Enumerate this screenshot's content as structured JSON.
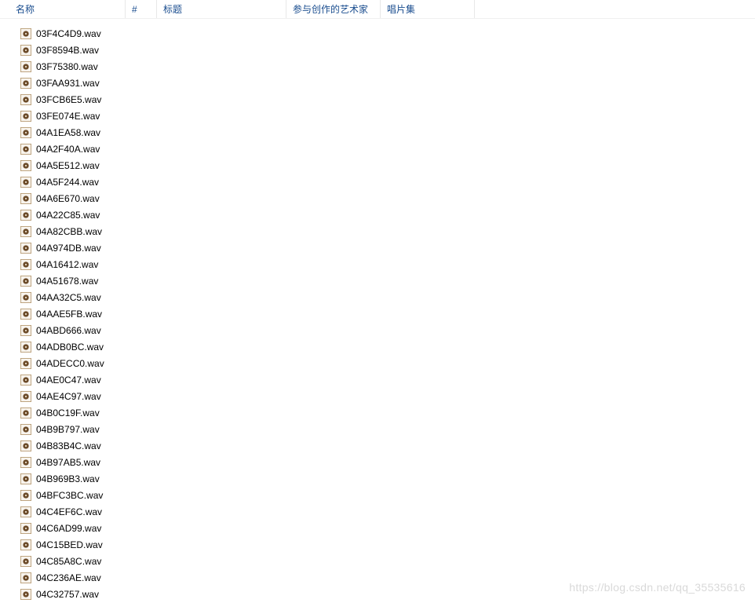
{
  "columns": {
    "name": "名称",
    "num": "#",
    "title": "标题",
    "artist": "参与创作的艺术家",
    "album": "唱片集"
  },
  "files": [
    "03F4C4D9.wav",
    "03F8594B.wav",
    "03F75380.wav",
    "03FAA931.wav",
    "03FCB6E5.wav",
    "03FE074E.wav",
    "04A1EA58.wav",
    "04A2F40A.wav",
    "04A5E512.wav",
    "04A5F244.wav",
    "04A6E670.wav",
    "04A22C85.wav",
    "04A82CBB.wav",
    "04A974DB.wav",
    "04A16412.wav",
    "04A51678.wav",
    "04AA32C5.wav",
    "04AAE5FB.wav",
    "04ABD666.wav",
    "04ADB0BC.wav",
    "04ADECC0.wav",
    "04AE0C47.wav",
    "04AE4C97.wav",
    "04B0C19F.wav",
    "04B9B797.wav",
    "04B83B4C.wav",
    "04B97AB5.wav",
    "04B969B3.wav",
    "04BFC3BC.wav",
    "04C4EF6C.wav",
    "04C6AD99.wav",
    "04C15BED.wav",
    "04C85A8C.wav",
    "04C236AE.wav",
    "04C32757.wav"
  ],
  "watermark": "https://blog.csdn.net/qq_35535616"
}
